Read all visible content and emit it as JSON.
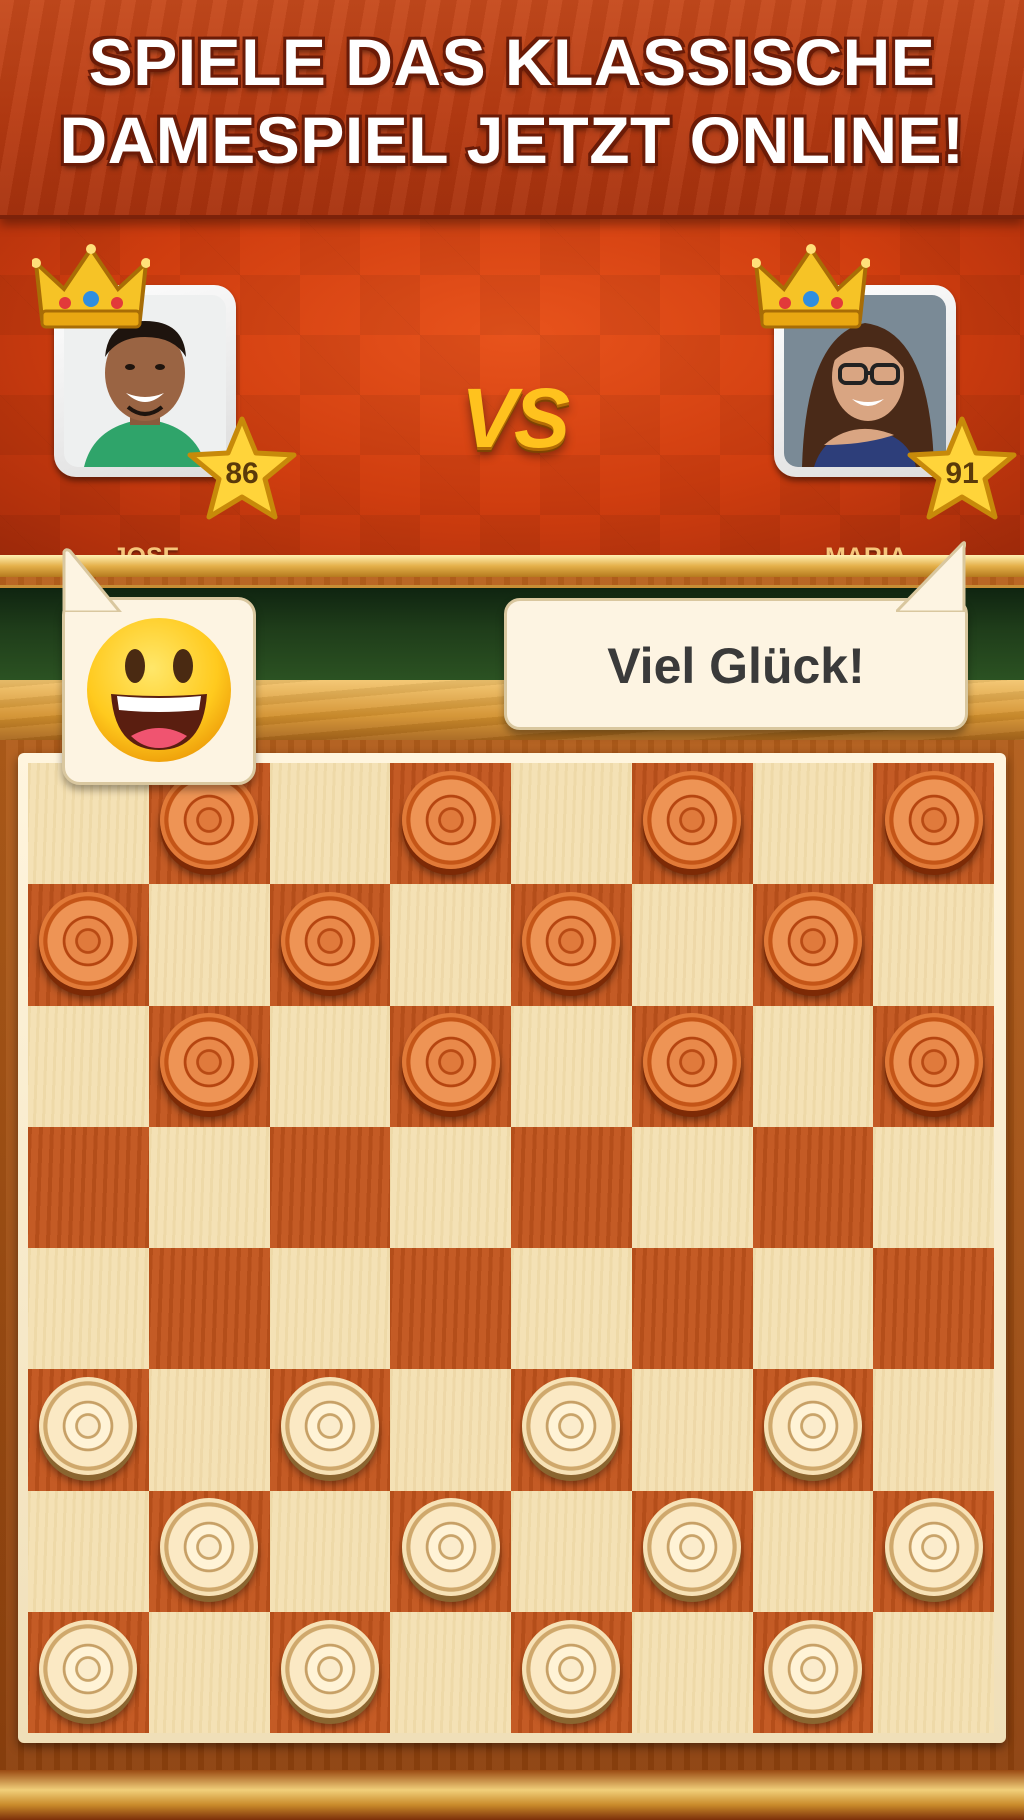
{
  "header": {
    "line1": "SPIELE DAS KLASSISCHE",
    "line2": "DAMESPIEL JETZT ONLINE!"
  },
  "players": {
    "left": {
      "name": "JOSE",
      "level": "86",
      "avatar": "male-player-avatar"
    },
    "right": {
      "name": "MARIA",
      "level": "91",
      "avatar": "female-player-avatar"
    },
    "vs_label": "VS"
  },
  "chat": {
    "left_emoji": "grinning-face-emoji",
    "right_message": "Viel Glück!"
  },
  "board": {
    "size": 8,
    "rows": [
      "-r-r-r-r",
      "r-r-r-r-",
      "-r-r-r-r",
      "--------",
      "--------",
      "c-c-c-c-",
      "-c-c-c-c",
      "c-c-c-c-"
    ],
    "piece_colors": {
      "r": "orange-red",
      "c": "cream"
    }
  },
  "colors": {
    "banner": "#b83b12",
    "light_square": "#f3dfb0",
    "dark_square": "#c2541c",
    "vs_gold": "#ffc21e",
    "name_gold": "#f6c57a",
    "felt_green": "#1f3d1a"
  }
}
